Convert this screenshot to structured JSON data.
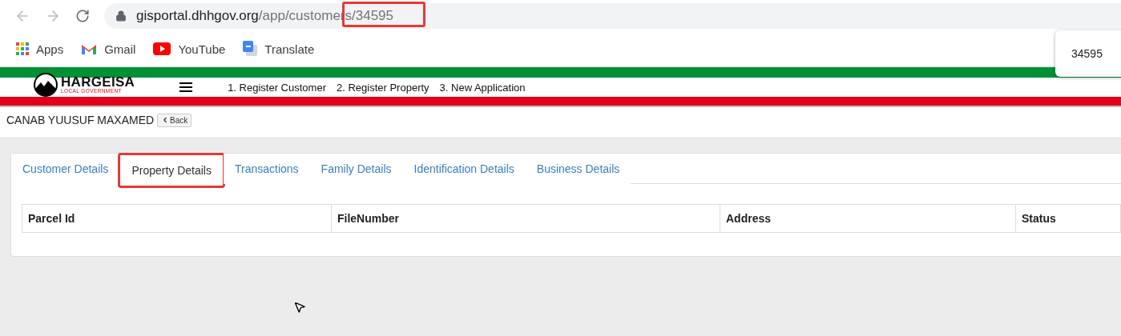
{
  "browser": {
    "url_host": "gisportal.dhhgov.org",
    "url_path": "/app/customers/34595",
    "url_annotated": true,
    "bookmarks": [
      "Apps",
      "Gmail",
      "YouTube",
      "Translate"
    ],
    "popup": "34595"
  },
  "header": {
    "logo_title": "HARGEISA",
    "logo_subtitle": "LOCAL GOVERNMENT",
    "nav": [
      "1. Register Customer",
      "2. Register Property",
      "3. New Application"
    ]
  },
  "customer": {
    "name": "CANAB YUUSUF MAXAMED",
    "back_button": "Back"
  },
  "tabs": [
    {
      "label": "Customer Details",
      "selected": false,
      "annotated": false
    },
    {
      "label": "Property Details",
      "selected": true,
      "annotated": true
    },
    {
      "label": "Transactions",
      "selected": false,
      "annotated": false
    },
    {
      "label": "Family Details",
      "selected": false,
      "annotated": false
    },
    {
      "label": "Identification Details",
      "selected": false,
      "annotated": false
    },
    {
      "label": "Business Details",
      "selected": false,
      "annotated": false
    }
  ],
  "table": {
    "columns": [
      "Parcel Id",
      "FileNumber",
      "Address",
      "Status"
    ]
  }
}
